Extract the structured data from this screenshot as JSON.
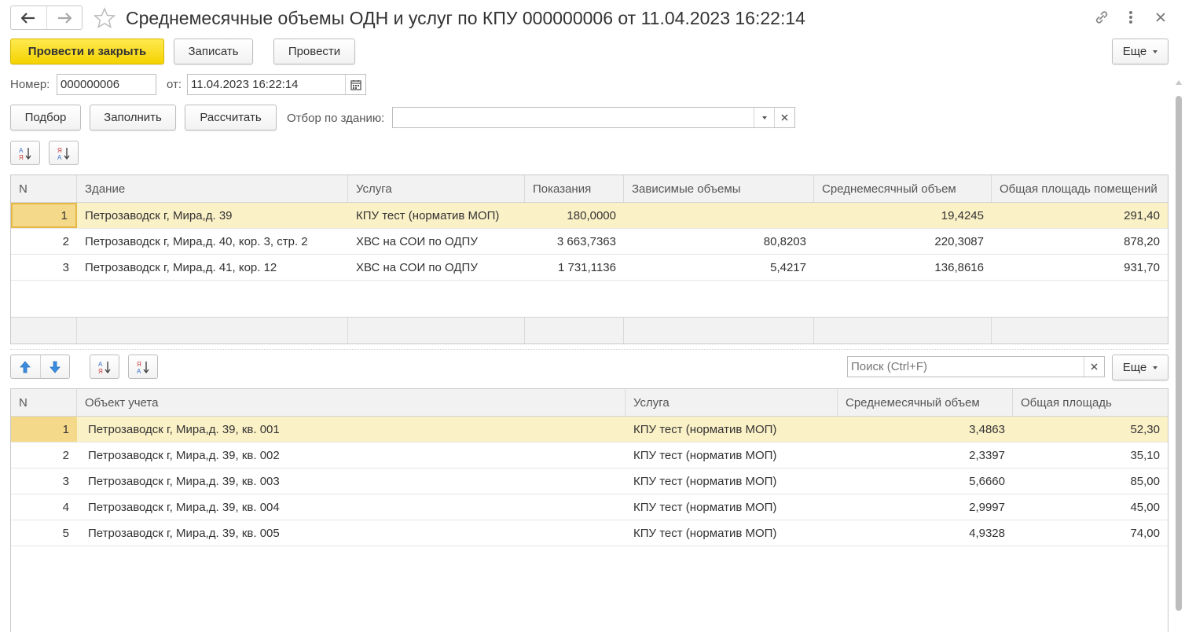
{
  "window": {
    "title": "Среднемесячные объемы ОДН и услуг по КПУ 000000006 от 11.04.2023 16:22:14"
  },
  "icons": {
    "back": "arrow-left-icon",
    "forward": "arrow-right-icon",
    "favorite": "star-icon",
    "link": "link-icon",
    "more": "kebab-menu-icon",
    "close": "close-icon"
  },
  "toolbar": {
    "post_close": "Провести и закрыть",
    "save": "Записать",
    "post": "Провести",
    "more": "Еще"
  },
  "header": {
    "number_label": "Номер:",
    "number_value": "000000006",
    "date_label": "от:",
    "date_value": "11.04.2023 16:22:14"
  },
  "actions": {
    "pick": "Подбор",
    "fill": "Заполнить",
    "calc": "Рассчитать",
    "filter_label": "Отбор по зданию:",
    "filter_value": ""
  },
  "table1": {
    "columns": [
      "N",
      "Здание",
      "Услуга",
      "Показания",
      "Зависимые объемы",
      "Среднемесячный объем",
      "Общая площадь помещений"
    ],
    "rows": [
      {
        "n": "1",
        "building": "Петрозаводск г, Мира,д. 39",
        "service": "КПУ тест (норматив МОП)",
        "readings": "180,0000",
        "dependent": "",
        "avg": "19,4245",
        "area": "291,40"
      },
      {
        "n": "2",
        "building": "Петрозаводск г, Мира,д. 40, кор. 3, стр. 2",
        "service": "ХВС на СОИ по ОДПУ",
        "readings": "3 663,7363",
        "dependent": "80,8203",
        "avg": "220,3087",
        "area": "878,20"
      },
      {
        "n": "3",
        "building": "Петрозаводск г, Мира,д. 41, кор. 12",
        "service": "ХВС на СОИ по ОДПУ",
        "readings": "1 731,1136",
        "dependent": "5,4217",
        "avg": "136,8616",
        "area": "931,70"
      }
    ]
  },
  "table2_toolbar": {
    "search_placeholder": "Поиск (Ctrl+F)",
    "more": "Еще"
  },
  "table2": {
    "columns": [
      "N",
      "Объект учета",
      "Услуга",
      "Среднемесячный объем",
      "Общая площадь"
    ],
    "rows": [
      {
        "n": "1",
        "object": "Петрозаводск г, Мира,д. 39, кв. 001",
        "service": "КПУ тест (норматив МОП)",
        "avg": "3,4863",
        "area": "52,30"
      },
      {
        "n": "2",
        "object": "Петрозаводск г, Мира,д. 39, кв. 002",
        "service": "КПУ тест (норматив МОП)",
        "avg": "2,3397",
        "area": "35,10"
      },
      {
        "n": "3",
        "object": "Петрозаводск г, Мира,д. 39, кв. 003",
        "service": "КПУ тест (норматив МОП)",
        "avg": "5,6660",
        "area": "85,00"
      },
      {
        "n": "4",
        "object": "Петрозаводск г, Мира,д. 39, кв. 004",
        "service": "КПУ тест (норматив МОП)",
        "avg": "2,9997",
        "area": "45,00"
      },
      {
        "n": "5",
        "object": "Петрозаводск г, Мира,д. 39, кв. 005",
        "service": "КПУ тест (норматив МОП)",
        "avg": "4,9328",
        "area": "74,00"
      }
    ]
  },
  "colors": {
    "primary_button": "#f4d300",
    "selected_row": "#fbf1c7",
    "header_bg": "#f2f2f2",
    "arrow_blue": "#3a8de0"
  }
}
